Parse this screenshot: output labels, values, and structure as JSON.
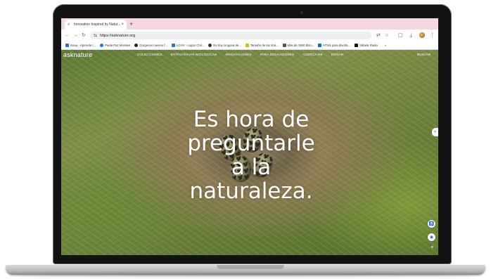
{
  "browser": {
    "tab_title": "Innovation Inspired by Natur...",
    "tab_close": "×",
    "new_tab": "+",
    "url": "https://asknature.org",
    "bookmarks": [
      {
        "label": "Issuu - Aprende t...",
        "color": "#1a73e8"
      },
      {
        "label": "Paola Paz Morales",
        "color": "#1877f2"
      },
      {
        "label": "Gorgeous nuevos f...",
        "color": "#222222"
      },
      {
        "label": "LCHV - Logos Chil...",
        "color": "#3a6cd8"
      },
      {
        "label": "No hay ninguna de...",
        "color": "#333333"
      },
      {
        "label": "Tamaño de las imá...",
        "color": "#e8b400"
      },
      {
        "label": "Más de 1500 libro...",
        "color": "#555555"
      },
      {
        "label": "HTML para diseña...",
        "color": "#1d64c8"
      },
      {
        "label": "Sábela Radio",
        "color": "#111111"
      }
    ],
    "more_bookmarks": "»"
  },
  "site": {
    "logo": "asknature",
    "menu": [
      "COLECCIONES",
      "ESTRATEGIAS BIOLÓGICAS",
      "INNOVACIONES",
      "PARA EDUCADORES",
      "ACERCA DE",
      "DONAR"
    ],
    "search": "BUSCAR",
    "hero_lines": [
      "Es hora de",
      "preguntarle",
      "a la",
      "naturaleza."
    ],
    "side_tab_icon": "«",
    "plus": "+"
  }
}
